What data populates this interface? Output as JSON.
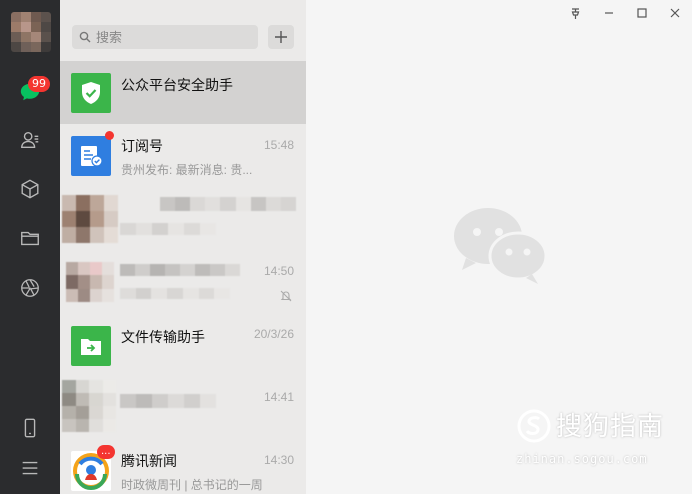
{
  "window": {
    "pin_icon": "pin-icon",
    "minimize_icon": "minimize-icon",
    "maximize_icon": "maximize-icon",
    "close_icon": "close-icon"
  },
  "sidebar": {
    "unread_badge": "99",
    "items": [
      {
        "icon": "chat-icon"
      },
      {
        "icon": "contacts-icon"
      },
      {
        "icon": "mini-program-cube-icon"
      },
      {
        "icon": "folder-icon"
      },
      {
        "icon": "moments-aperture-icon"
      },
      {
        "icon": "phone-icon"
      },
      {
        "icon": "menu-icon"
      }
    ]
  },
  "search": {
    "placeholder": "搜索"
  },
  "conversations": [
    {
      "name": "公众平台安全助手",
      "time": "",
      "preview": "",
      "icon": "shield-check-icon",
      "color": "#3bb54a"
    },
    {
      "name": "订阅号",
      "time": "15:48",
      "preview": "贵州发布: 最新消息: 贵...",
      "icon": "subscription-icon",
      "color": "#2f7ee0"
    },
    {
      "name": "",
      "time": "",
      "preview": ""
    },
    {
      "name": "",
      "time": "14:50",
      "preview": ""
    },
    {
      "name": "文件传输助手",
      "time": "20/3/26",
      "preview": "",
      "icon": "file-transfer-icon",
      "color": "#3bb54a"
    },
    {
      "name": "",
      "time": "14:41",
      "preview": ""
    },
    {
      "name": "腾讯新闻",
      "time": "14:30",
      "preview": "时政微周刊 | 总书记的一周",
      "icon": "tencent-news-icon",
      "badge": "..."
    }
  ],
  "watermark": {
    "brand": "搜狗指南",
    "domain": "zhinan.sogou.com"
  },
  "colors": {
    "rail": "#2b2c2e",
    "list": "#ebeae9",
    "selected": "#d3d2d1",
    "accent": "#3bb54a",
    "badge": "#f43530"
  }
}
